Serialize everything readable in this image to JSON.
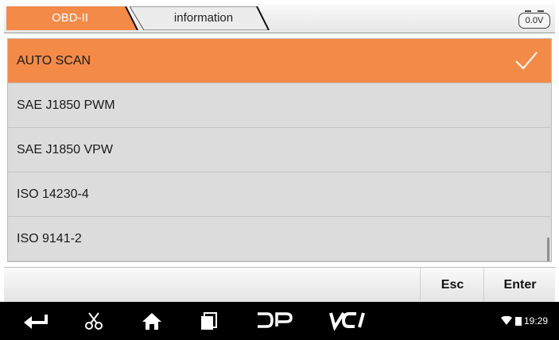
{
  "tabs": {
    "obd_label": "OBD-II",
    "info_label": "information"
  },
  "voltage": "0.0V",
  "list": {
    "items": [
      {
        "label": "AUTO SCAN",
        "selected": true
      },
      {
        "label": "SAE J1850 PWM",
        "selected": false
      },
      {
        "label": "SAE J1850 VPW",
        "selected": false
      },
      {
        "label": "ISO 14230-4",
        "selected": false
      },
      {
        "label": "ISO 9141-2",
        "selected": false
      }
    ]
  },
  "footer": {
    "esc_label": "Esc",
    "enter_label": "Enter"
  },
  "navbar": {
    "icons": [
      "back-icon",
      "scissors-icon",
      "home-icon",
      "recent-apps-icon",
      "dp-icon",
      "vci-icon"
    ],
    "dp_label": "DP",
    "vci_label": "VCI",
    "time": "19:29"
  },
  "colors": {
    "accent": "#f48a48",
    "list_bg": "#dcdcdc",
    "nav_bg": "#000000"
  }
}
